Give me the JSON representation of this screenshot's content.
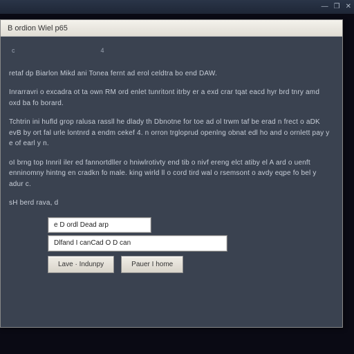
{
  "titlebar": {
    "min": "—",
    "max": "❐",
    "close": "✕"
  },
  "window": {
    "title": "B ordion Wiel p65"
  },
  "header": {
    "a": "c",
    "b": "4"
  },
  "paragraphs": [
    "retaf dp Biarlon Mikd ani Tonea fernt ad erol celdtra bo end DAW.",
    "Inrarravri o excadra ot ta own RM ord enlet tunritont itrby er a exd crar tqat eacd hyr brd tnry amd oxd ba fo borard.",
    "Tchtrin ini hufld grop ralusa rassll he dlady th Dbnotne for toe ad ol trwm taf be erad n frect o aDK evB by ort fal urle lontnrd a endm cekef 4. n orron trgloprud openlng obnat edl ho and o ornlett pay y e of earl y n.",
    "oI brng top Innril iler ed fannortdller o hniwlrotivty end tib o nivf ereng elct atiby el A ard o uenft enninomny hintng en cradkn fo male. king wirld ll o cord tird wal o rsemsont o avdy eqpe fo bel y adur c.",
    "sH berd rava, d"
  ],
  "option1": "e D ordl Dead arp",
  "option2": "Dlfand I canCad O D can",
  "btn1": "Lave · Indunpy",
  "btn2": "Pauer I home"
}
